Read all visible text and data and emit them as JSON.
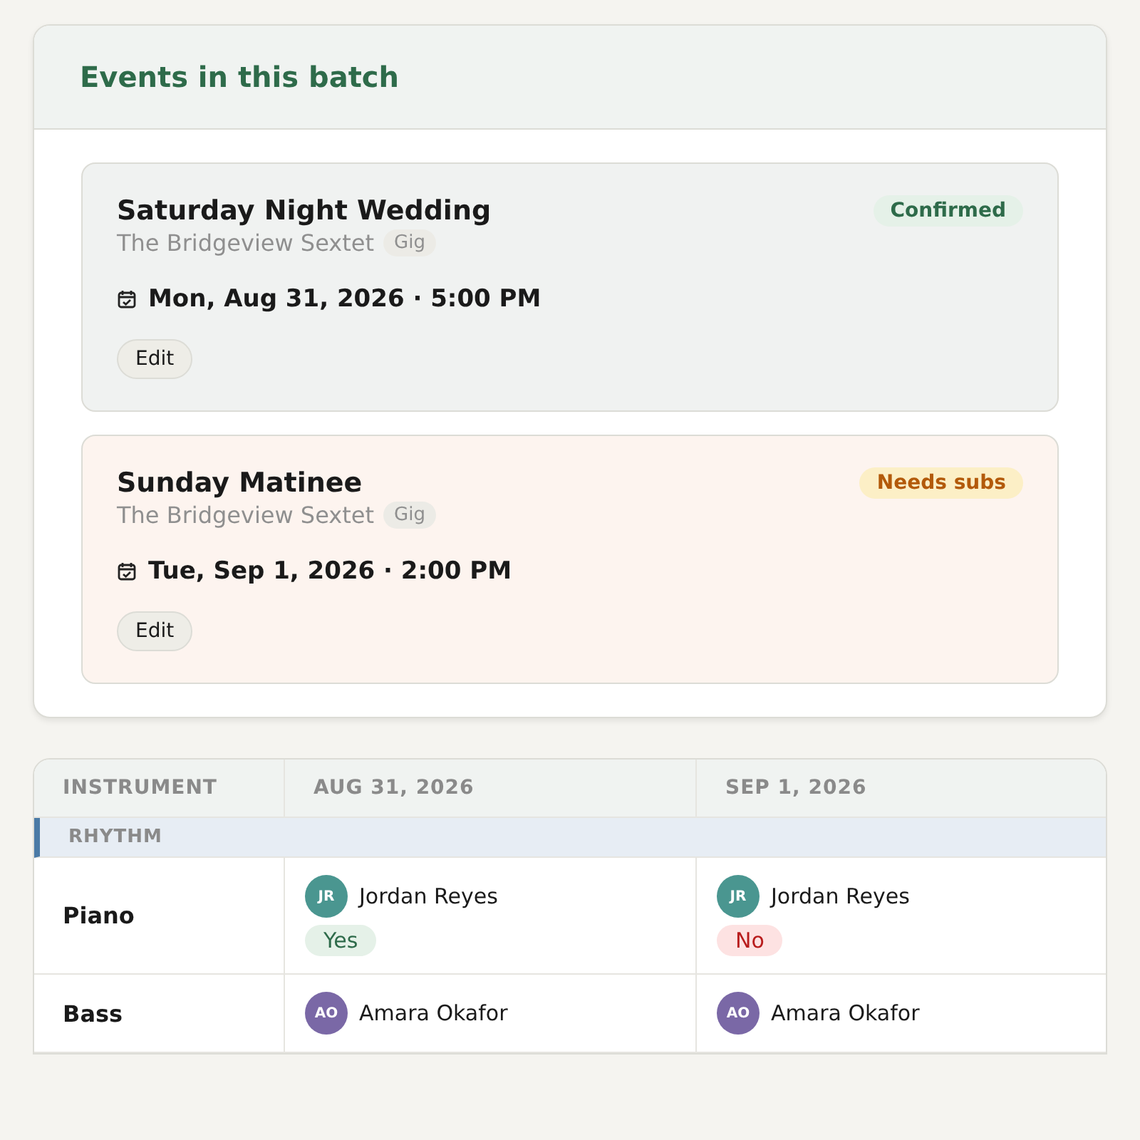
{
  "events_panel": {
    "title": "Events in this batch",
    "events": [
      {
        "title": "Saturday Night Wedding",
        "ensemble": "The Bridgeview Sextet",
        "type_tag": "Gig",
        "datetime": "Mon, Aug 31, 2026 · 5:00 PM",
        "status": {
          "kind": "confirmed",
          "label": "Confirmed"
        },
        "edit_label": "Edit"
      },
      {
        "title": "Sunday Matinee",
        "ensemble": "The Bridgeview Sextet",
        "type_tag": "Gig",
        "datetime": "Tue, Sep 1, 2026 · 2:00 PM",
        "status": {
          "kind": "needs_subs",
          "label": "Needs subs"
        },
        "edit_label": "Edit"
      }
    ]
  },
  "roster": {
    "columns": [
      "INSTRUMENT",
      "AUG 31, 2026",
      "SEP 1, 2026"
    ],
    "sections": [
      {
        "name": "RHYTHM",
        "rows": [
          {
            "instrument": "Piano",
            "cells": [
              {
                "initials": "JR",
                "name": "Jordan Reyes",
                "color": "#4a9690",
                "response": {
                  "kind": "yes",
                  "label": "Yes"
                }
              },
              {
                "initials": "JR",
                "name": "Jordan Reyes",
                "color": "#4a9690",
                "response": {
                  "kind": "no",
                  "label": "No"
                }
              }
            ]
          },
          {
            "instrument": "Bass",
            "cells": [
              {
                "initials": "AO",
                "name": "Amara Okafor",
                "color": "#7a68a6"
              },
              {
                "initials": "AO",
                "name": "Amara Okafor",
                "color": "#7a68a6"
              }
            ]
          }
        ]
      }
    ]
  }
}
